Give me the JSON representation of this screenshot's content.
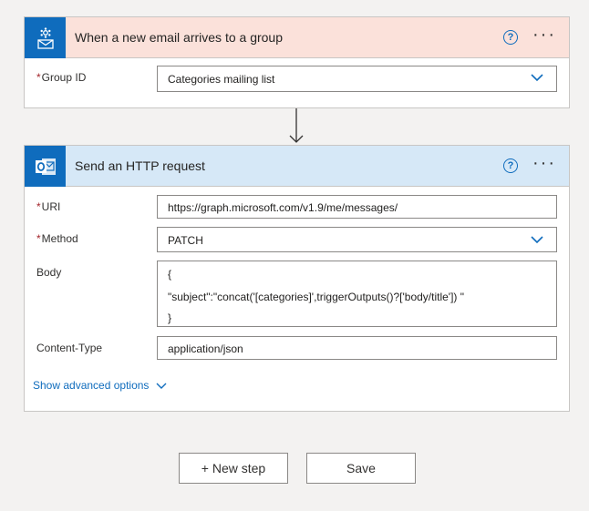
{
  "trigger": {
    "title": "When a new email arrives to a group",
    "help_glyph": "?",
    "more_glyph": "···",
    "fields": {
      "group_id": {
        "required_mark": "*",
        "label": "Group ID",
        "value": "Categories mailing list"
      }
    }
  },
  "action": {
    "title": "Send an HTTP request",
    "help_glyph": "?",
    "more_glyph": "···",
    "fields": {
      "uri": {
        "required_mark": "*",
        "label": "URI",
        "value": "https://graph.microsoft.com/v1.9/me/messages/"
      },
      "method": {
        "required_mark": "*",
        "label": "Method",
        "value": "PATCH"
      },
      "body": {
        "label": "Body",
        "lines": [
          "{",
          "\"subject\":\"concat('[categories]',triggerOutputs()?['body/title']) \"",
          "}"
        ]
      },
      "content_type": {
        "label": "Content-Type",
        "value": "application/json"
      }
    },
    "advanced_label": "Show advanced options"
  },
  "footer": {
    "new_step_label": "+ New step",
    "save_label": "Save"
  },
  "colors": {
    "trigger_header_bg": "#fbe1da",
    "action_header_bg": "#d6e8f7",
    "accent": "#0f6cbd",
    "required": "#a4262c"
  }
}
